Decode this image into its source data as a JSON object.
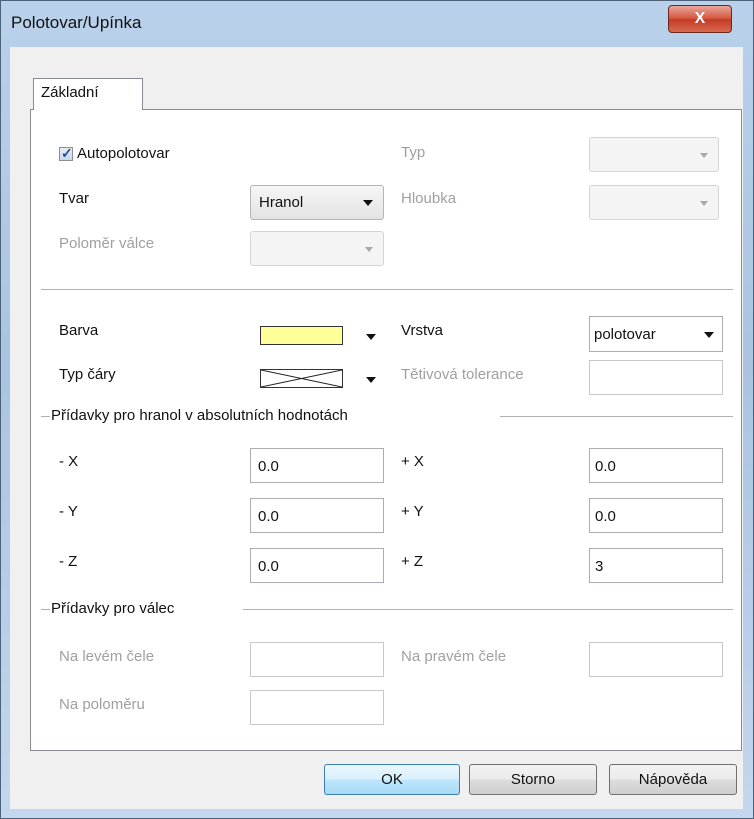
{
  "window": {
    "title": "Polotovar/Upínka",
    "close_glyph": "X"
  },
  "tab": {
    "label": "Základní"
  },
  "autopolotovar": {
    "label": "Autopolotovar",
    "checked": true,
    "check_glyph": "✓"
  },
  "fields": {
    "typ_label": "Typ",
    "tvar_label": "Tvar",
    "tvar_value": "Hranol",
    "hloubka_label": "Hloubka",
    "polomer_label": "Poloměr válce",
    "barva_label": "Barva",
    "barva_color": "#ffff99",
    "vrstva_label": "Vrstva",
    "vrstva_value": "polotovar",
    "typ_cary_label": "Typ čáry",
    "tetivova_label": "Tětivová tolerance"
  },
  "hranol_group": {
    "title": "Přídavky pro hranol v absolutních hodnotách",
    "minus_x_label": "- X",
    "minus_x_value": "0.0",
    "plus_x_label": "+ X",
    "plus_x_value": "0.0",
    "minus_y_label": "- Y",
    "minus_y_value": "0.0",
    "plus_y_label": "+ Y",
    "plus_y_value": "0.0",
    "minus_z_label": "- Z",
    "minus_z_value": "0.0",
    "plus_z_label": "+ Z",
    "plus_z_value": "3"
  },
  "valec_group": {
    "title": "Přídavky pro válec",
    "levem_label": "Na levém čele",
    "pravem_label": "Na pravém čele",
    "polomeru_label": "Na poloměru"
  },
  "buttons": {
    "ok": "OK",
    "storno": "Storno",
    "napoveda": "Nápověda"
  }
}
